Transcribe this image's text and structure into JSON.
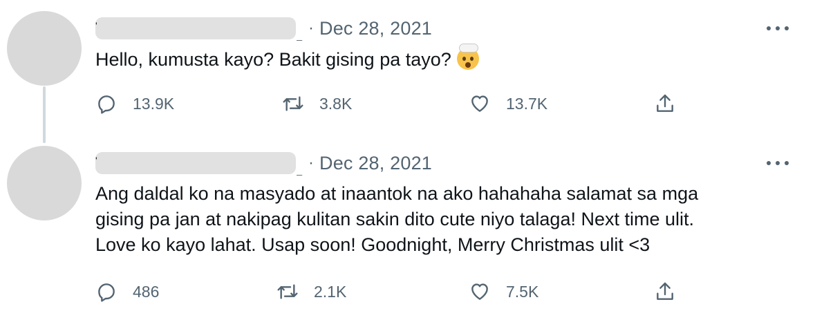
{
  "tweets": [
    {
      "separator": "·",
      "date": "Dec 28, 2021",
      "text": "Hello, kumusta kayo? Bakit gising pa tayo?",
      "emoji": "exploding-head",
      "replies": "13.9K",
      "retweets": "3.8K",
      "likes": "13.7K"
    },
    {
      "separator": "·",
      "date": "Dec 28, 2021",
      "text": "Ang daldal ko na masyado at inaantok na ako hahahaha salamat sa mga\ngising pa jan at nakipag kulitan sakin dito cute niyo talaga! Next time ulit.\nLove ko kayo lahat. Usap soon! Goodnight, Merry Christmas ulit <3",
      "replies": "486",
      "retweets": "2.1K",
      "likes": "7.5K"
    }
  ],
  "icons": {
    "reply": "reply-icon",
    "retweet": "retweet-icon",
    "like": "heart-icon",
    "share": "share-icon",
    "more": "more-options-icon"
  },
  "colors": {
    "secondary_text": "#536471",
    "primary_text": "#0f1419",
    "redacted": "#e1e1e1",
    "thread_line": "#cfd9de"
  }
}
